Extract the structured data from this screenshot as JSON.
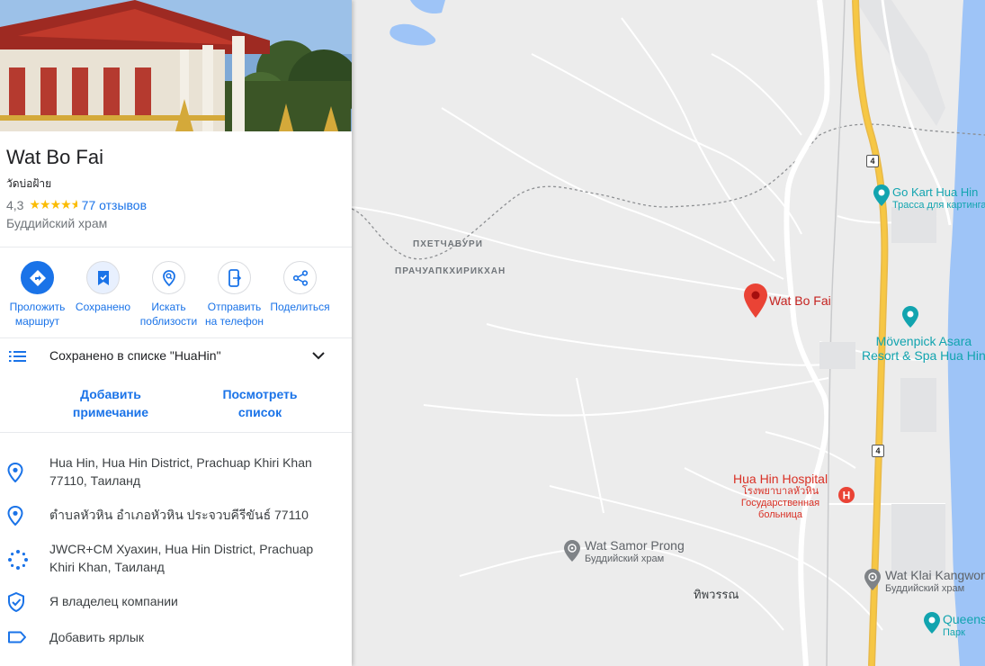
{
  "place": {
    "title": "Wat Bo Fai",
    "local_name": "วัดบ่อฝ้าย",
    "rating": "4,3",
    "rating_value": 4.3,
    "reviews": "77 отзывов",
    "category": "Буддийский храм"
  },
  "actions": [
    {
      "label": "Проложить маршрут",
      "icon": "directions-icon"
    },
    {
      "label": "Сохранено",
      "icon": "bookmark-icon"
    },
    {
      "label": "Искать поблизости",
      "icon": "nearby-icon"
    },
    {
      "label": "Отправить на телефон",
      "icon": "send-to-phone-icon"
    },
    {
      "label": "Поделиться",
      "icon": "share-icon"
    }
  ],
  "saved": {
    "text": "Сохранено в списке \"HuaHin\"",
    "add_note": "Добавить примечание",
    "view_list": "Посмотреть список"
  },
  "info": {
    "address": "Hua Hin, Hua Hin District, Prachuap Khiri Khan 77110, Таиланд",
    "address_thai": "ตำบลหัวหิน อำเภอหัวหิน ประจวบคีรีขันธ์ 77110",
    "plus_code": "JWCR+CM Хуахин, Hua Hin District, Prachuap Khiri Khan, Таиланд",
    "claim": "Я владелец компании",
    "add_label": "Добавить ярлык"
  },
  "map": {
    "areas": [
      "ПХЕТЧАБУРИ",
      "ПРАЧУАПКХИРИКХАН"
    ],
    "route_number": "4",
    "pois": {
      "selected": "Wat Bo Fai",
      "go_kart": {
        "name": "Go Kart Hua Hin",
        "sub": "Трасса для картинга"
      },
      "movenpick": {
        "line1": "Mövenpick Asara",
        "line2": "Resort & Spa Hua Hin"
      },
      "hospital": {
        "name": "Hua Hin Hospital",
        "thai": "โรงพยาบาลหัวหิน",
        "sub1": "Государственная",
        "sub2": "больница"
      },
      "wat_samor": {
        "name": "Wat Samor Prong",
        "sub": "Буддийский храм"
      },
      "wat_klai": {
        "name": "Wat Klai Kangwon",
        "sub": "Буддийский храм"
      },
      "queens": {
        "name": "Queens",
        "sub": "Парк"
      },
      "thipwaran": "ทิพวรรณ"
    },
    "colors": {
      "land": "#ececec",
      "water": "#9ec4f7",
      "highway": "#f6c744",
      "poi_teal": "#12a4af",
      "pin_red": "#ea4335"
    }
  }
}
